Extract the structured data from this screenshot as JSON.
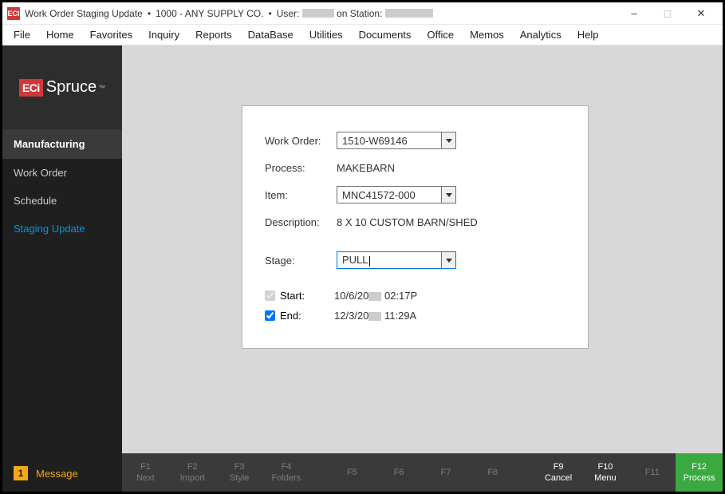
{
  "titlebar": {
    "app_icon_text": "ECI",
    "title": "Work Order Staging Update",
    "company": "1000 - ANY SUPPLY CO.",
    "user_label": "User:",
    "station_label": "on Station:"
  },
  "menubar": [
    "File",
    "Home",
    "Favorites",
    "Inquiry",
    "Reports",
    "DataBase",
    "Utilities",
    "Documents",
    "Office",
    "Memos",
    "Analytics",
    "Help"
  ],
  "sidebar": {
    "logo_eci": "ECi",
    "logo_spruce": "Spruce",
    "module": "Manufacturing",
    "items": [
      {
        "label": "Work Order",
        "active": false
      },
      {
        "label": "Schedule",
        "active": false
      },
      {
        "label": "Staging Update",
        "active": true
      }
    ],
    "message_count": "1",
    "message_label": "Message"
  },
  "form": {
    "work_order_label": "Work Order:",
    "work_order_value": "1510-W69146",
    "process_label": "Process:",
    "process_value": "MAKEBARN",
    "item_label": "Item:",
    "item_value": "MNC41572-000",
    "description_label": "Description:",
    "description_value": "8 X 10 CUSTOM BARN/SHED",
    "stage_label": "Stage:",
    "stage_value": "PULL",
    "start_label": "Start:",
    "start_value_pre": "10/6/20",
    "start_value_post": " 02:17P",
    "end_label": "End:",
    "end_value_pre": "12/3/20",
    "end_value_post": " 11:29A"
  },
  "fkeys": [
    {
      "key": "F1",
      "label": "Next",
      "enabled": false
    },
    {
      "key": "F2",
      "label": "Import",
      "enabled": false
    },
    {
      "key": "F3",
      "label": "Style",
      "enabled": false
    },
    {
      "key": "F4",
      "label": "Folders",
      "enabled": false
    },
    {
      "key": "F5",
      "label": "",
      "enabled": false
    },
    {
      "key": "F6",
      "label": "",
      "enabled": false
    },
    {
      "key": "F7",
      "label": "",
      "enabled": false
    },
    {
      "key": "F8",
      "label": "",
      "enabled": false
    },
    {
      "key": "F9",
      "label": "Cancel",
      "enabled": true
    },
    {
      "key": "F10",
      "label": "Menu",
      "enabled": true
    },
    {
      "key": "F11",
      "label": "",
      "enabled": false
    },
    {
      "key": "F12",
      "label": "Process",
      "enabled": true,
      "process": true
    }
  ]
}
